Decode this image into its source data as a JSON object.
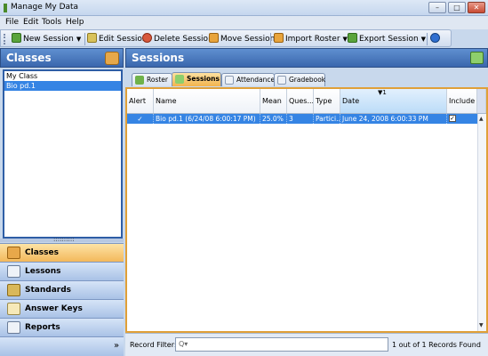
{
  "window": {
    "title": "Manage My Data",
    "controls": [
      "–",
      "□",
      "✕"
    ]
  },
  "menu": [
    "File",
    "Edit",
    "Tools",
    "Help"
  ],
  "toolbar": {
    "new_session": "New Session",
    "edit_session": "Edit Session",
    "delete_session": "Delete Session",
    "move_session": "Move Session",
    "import_roster": "Import Roster",
    "export_session": "Export Session",
    "help_icon": "help-icon"
  },
  "left": {
    "header": "Classes",
    "classes": [
      "My Class",
      "Bio pd.1"
    ],
    "selected_class": "Bio pd.1",
    "splitter_grip": "::::::::::",
    "nav": [
      {
        "label": "Classes",
        "icon": "classes-icon",
        "active": true
      },
      {
        "label": "Lessons",
        "icon": "lessons-icon",
        "active": false
      },
      {
        "label": "Standards",
        "icon": "standards-icon",
        "active": false
      },
      {
        "label": "Answer Keys",
        "icon": "answer-keys-icon",
        "active": false
      },
      {
        "label": "Reports",
        "icon": "reports-icon",
        "active": false
      }
    ],
    "expand_glyph": "»"
  },
  "right": {
    "header": "Sessions",
    "tabs": [
      {
        "label": "Roster",
        "active": false
      },
      {
        "label": "Sessions",
        "active": true
      },
      {
        "label": "Attendance",
        "active": false
      },
      {
        "label": "Gradebook",
        "active": false
      }
    ],
    "columns": [
      "Alert",
      "Name",
      "Mean",
      "Ques...",
      "Type",
      "Date",
      "Include"
    ],
    "sort_indicator": "▼1",
    "rows": [
      {
        "alert": "✓",
        "name": "Bio pd.1 (6/24/08 6:00:17 PM)",
        "mean": "25.0%",
        "questions": "3",
        "type": "Partici...",
        "date": "June 24, 2008 6:00:33 PM",
        "include": true
      }
    ],
    "record_filter_label": "Record Filter:",
    "record_filter_placeholder": "Q▾",
    "record_count": "1 out of 1 Records Found"
  },
  "colors": {
    "header_blue": "#3a67ad",
    "selection_blue": "#3584e4",
    "active_orange": "#f2b34e"
  }
}
